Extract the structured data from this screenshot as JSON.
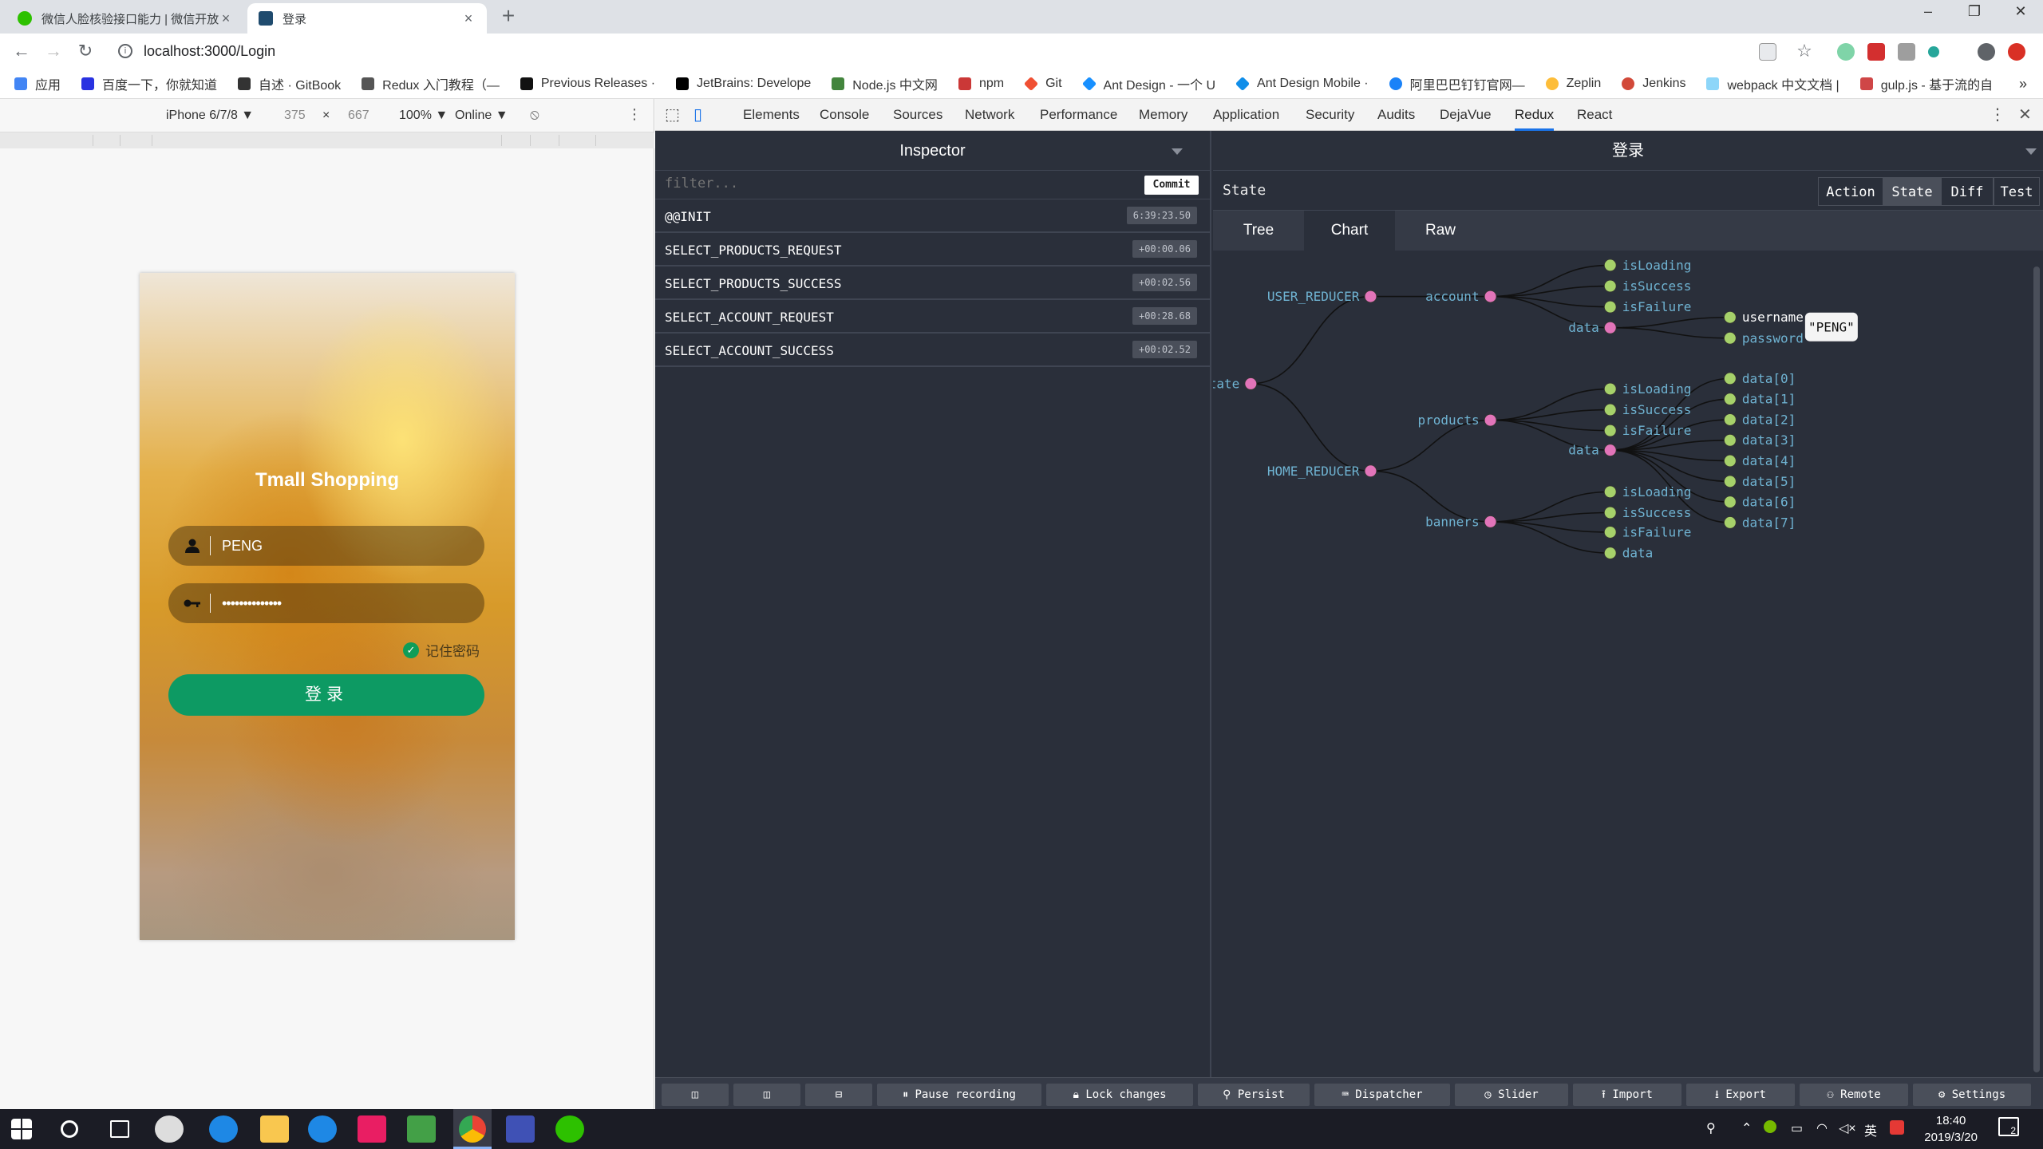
{
  "browser": {
    "tabs": [
      {
        "title": "微信人脸核验接口能力 | 微信开放",
        "favicon_color": "#2dc100"
      },
      {
        "title": "登录",
        "favicon_color": "#1f4b6e"
      }
    ],
    "url": "localhost:3000/Login",
    "bookmarks": [
      {
        "label": "应用",
        "color": "#4285f4"
      },
      {
        "label": "百度一下，你就知道",
        "color": "#2932e1"
      },
      {
        "label": "自述 · GitBook",
        "color": "#333333"
      },
      {
        "label": "Redux 入门教程（—",
        "color": "#555555"
      },
      {
        "label": "Previous Releases ·",
        "color": "#111111"
      },
      {
        "label": "JetBrains: Develope",
        "color": "#000000"
      },
      {
        "label": "Node.js 中文网",
        "color": "#43853d"
      },
      {
        "label": "npm",
        "color": "#cb3837"
      },
      {
        "label": "Git",
        "color": "#f05033"
      },
      {
        "label": "Ant Design - 一个 U",
        "color": "#1890ff"
      },
      {
        "label": "Ant Design Mobile ·",
        "color": "#108ee9"
      },
      {
        "label": "阿里巴巴钉钉官网—",
        "color": "#1a82f8"
      },
      {
        "label": "Zeplin",
        "color": "#fdbd39"
      },
      {
        "label": "Jenkins",
        "color": "#d24939"
      },
      {
        "label": "webpack 中文文档 |",
        "color": "#8dd6f9"
      },
      {
        "label": "gulp.js - 基于流的自",
        "color": "#cf4647"
      }
    ],
    "more": "»"
  },
  "device_toolbar": {
    "device": "iPhone 6/7/8 ▼",
    "width": "375",
    "times": "×",
    "height": "667",
    "zoom": "100% ▼",
    "network": "Online ▼"
  },
  "phone": {
    "title": "Tmall Shopping",
    "username_value": "PENG",
    "password_value": "••••••••••••••",
    "remember_label": "记住密码",
    "login_label": "登录"
  },
  "devtools": {
    "tabs": [
      "Elements",
      "Console",
      "Sources",
      "Network",
      "Performance",
      "Memory",
      "Application",
      "Security",
      "Audits",
      "DejaVue",
      "Redux",
      "React"
    ],
    "active_tab": "Redux"
  },
  "inspector": {
    "title": "Inspector",
    "filter_placeholder": "filter...",
    "commit_label": "Commit",
    "actions": [
      {
        "name": "@@INIT",
        "time": "6:39:23.50"
      },
      {
        "name": "SELECT_PRODUCTS_REQUEST",
        "time": "+00:00.06"
      },
      {
        "name": "SELECT_PRODUCTS_SUCCESS",
        "time": "+00:02.56"
      },
      {
        "name": "SELECT_ACCOUNT_REQUEST",
        "time": "+00:28.68"
      },
      {
        "name": "SELECT_ACCOUNT_SUCCESS",
        "time": "+00:02.52"
      }
    ]
  },
  "monitor": {
    "title": "登录",
    "section": "State",
    "segments": [
      "Action",
      "State",
      "Diff",
      "Test"
    ],
    "active_segment": "State",
    "views": [
      "Tree",
      "Chart",
      "Raw"
    ],
    "active_view": "Chart"
  },
  "tree_chart": {
    "root": "state",
    "nodes": {
      "user_reducer": "USER_REDUCER",
      "account": "account",
      "acc_isLoading": "isLoading",
      "acc_isSuccess": "isSuccess",
      "acc_isFailure": "isFailure",
      "acc_data": "data",
      "username": "username",
      "password": "password",
      "username_tip": "\"PENG\"",
      "home_reducer": "HOME_REDUCER",
      "products": "products",
      "prod_isLoading": "isLoading",
      "prod_isSuccess": "isSuccess",
      "prod_isFailure": "isFailure",
      "prod_data": "data",
      "banners": "banners",
      "ban_isLoading": "isLoading",
      "ban_isSuccess": "isSuccess",
      "ban_isFailure": "isFailure",
      "ban_data": "data",
      "items": [
        "data[0]",
        "data[1]",
        "data[2]",
        "data[3]",
        "data[4]",
        "data[5]",
        "data[6]",
        "data[7]"
      ]
    },
    "colors": {
      "branch": "#e274b9",
      "leaf": "#a6d16a",
      "link": "#111111",
      "label": "#6fb3d2"
    }
  },
  "dock": {
    "buttons": [
      "Pause recording",
      "Lock changes",
      "Persist",
      "Dispatcher",
      "Slider",
      "Import",
      "Export",
      "Remote",
      "Settings"
    ]
  },
  "taskbar": {
    "time": "18:40",
    "date": "2019/3/20",
    "ime": "英",
    "notifications": "2"
  }
}
